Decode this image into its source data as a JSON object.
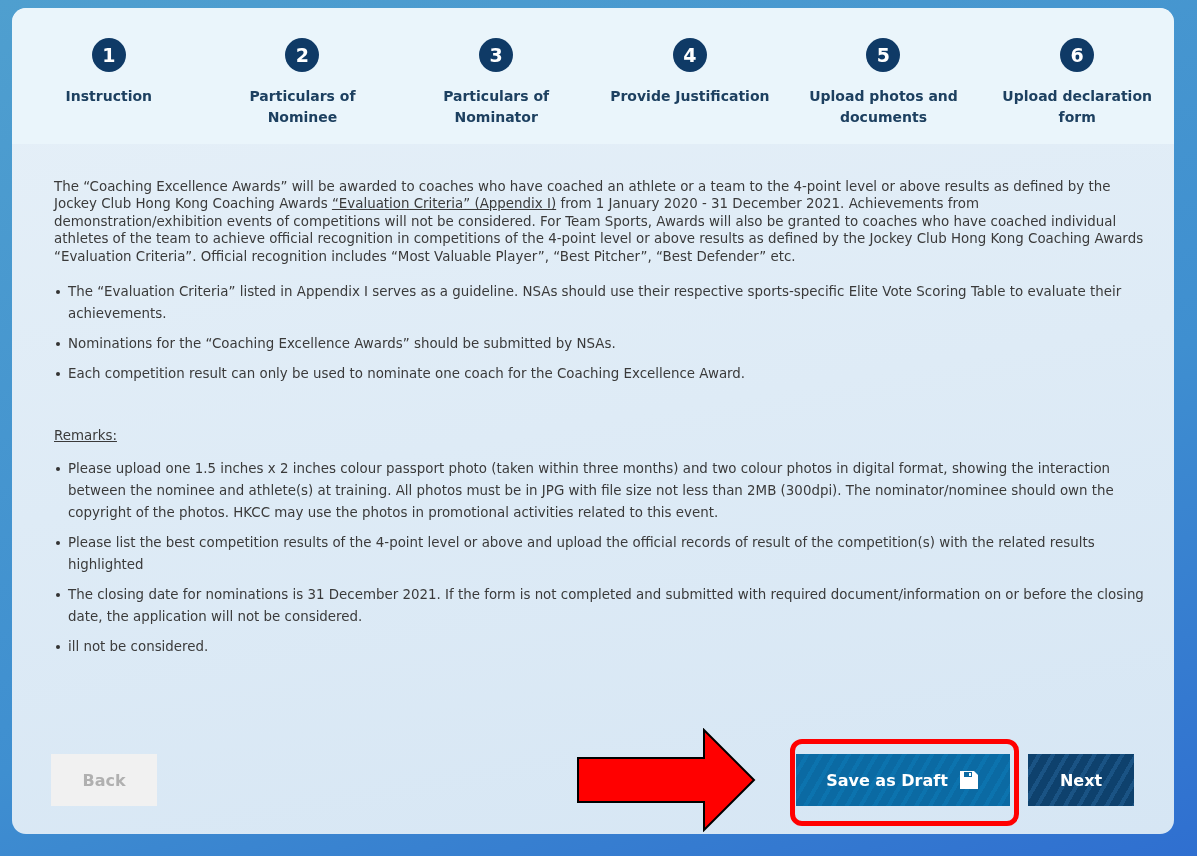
{
  "steps": [
    {
      "number": "1",
      "label": "Instruction"
    },
    {
      "number": "2",
      "label": "Particulars of Nominee"
    },
    {
      "number": "3",
      "label": "Particulars of Nominator"
    },
    {
      "number": "4",
      "label": "Provide Justification"
    },
    {
      "number": "5",
      "label": "Upload photos and documents"
    },
    {
      "number": "6",
      "label": "Upload declaration form"
    }
  ],
  "intro": {
    "before": "The “Coaching Excellence Awards” will be awarded to coaches who have coached an athlete or a team to the 4-point level or above results as defined by the Jockey Club Hong Kong Coaching Awards ",
    "link": "“Evaluation Criteria” (Appendix I)",
    "after": " from 1 January 2020 - 31 December 2021. Achievements from demonstration/exhibition events of competitions will not be considered. For Team Sports, Awards will also be granted to coaches who have coached individual athletes of the team to achieve official recognition in competitions of the 4-point level or above results as defined by the Jockey Club Hong Kong Coaching Awards “Evaluation Criteria”. Official recognition includes “Most Valuable Player”, “Best Pitcher”, “Best Defender” etc."
  },
  "bullets": [
    "The “Evaluation Criteria” listed in Appendix I serves as a guideline. NSAs should use their respective sports-specific Elite Vote Scoring Table to evaluate their achievements.",
    "Nominations for the “Coaching Excellence Awards” should be submitted by NSAs.",
    "Each competition result can only be used to nominate one coach for the Coaching Excellence Award."
  ],
  "remarks_heading": "Remarks:",
  "remarks": [
    "Please upload one 1.5 inches x 2 inches colour passport photo (taken within three months) and two colour photos in digital format, showing the interaction between the nominee and athlete(s) at training. All photos must be in JPG with file size not less than 2MB (300dpi). The nominator/nominee should own the copyright of the photos. HKCC may use the photos in promotional activities related to this event.",
    "Please list the best competition results of the 4-point level or above and upload the official records of result of the competition(s) with the related results highlighted",
    "The closing date for nominations is 31 December 2021. If the form is not completed and submitted with required document/information on or before the closing date, the application will not be considered.",
    "ill not be considered."
  ],
  "buttons": [
    {
      "kind": "back",
      "label": "Back",
      "disabled": true
    },
    {
      "kind": "draft",
      "label": "Save as Draft",
      "disabled": false
    },
    {
      "kind": "next",
      "label": "Next",
      "disabled": false
    }
  ]
}
